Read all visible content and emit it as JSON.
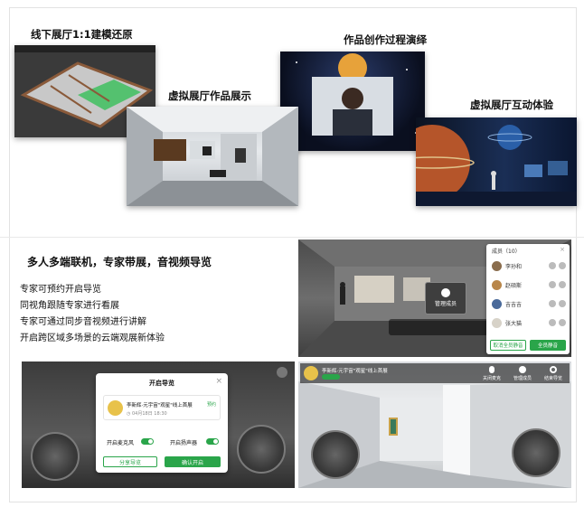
{
  "sections": {
    "top_labels": {
      "offline_model": "线下展厅1:1建模还原",
      "process": "作品创作过程演绎",
      "virtual_display": "虚拟展厅作品展示",
      "interactive": "虚拟展厅互动体验"
    },
    "middle": {
      "heading": "多人多端联机，专家带展，音视频导览",
      "bullets": [
        "专家可预约开启导览",
        "同视角跟随专家进行看展",
        "专家可通过同步音视频进行讲解",
        "开启跨区域多场景的云端观展新体验"
      ]
    }
  },
  "members_panel": {
    "title": "成员（10）",
    "manage_label": "管理成员",
    "rows": [
      "李孙和",
      "赵硕斯",
      "吉吉吉",
      "张大猫"
    ],
    "btn_all_mute": "取消全员静音",
    "btn_all_unmute": "全员静音"
  },
  "tour_dialog": {
    "title": "开启导览",
    "event_title": "李新辉·元宇宙\"观星\"线上首展",
    "event_status": "预约",
    "event_time": "04月18日 18:30",
    "mic_label": "开启麦克风",
    "speaker_label": "开启扬声器",
    "share_btn": "分享导览",
    "confirm_btn": "确认开启"
  },
  "live_bar": {
    "title": "李新辉·元宇宙\"观星\"线上首展",
    "icons": [
      {
        "icon": "mic-icon",
        "label": "关闭麦克"
      },
      {
        "icon": "members-icon",
        "label": "管理成员"
      },
      {
        "icon": "gear-icon",
        "label": "结束导览"
      }
    ]
  },
  "colors": {
    "accent_green": "#2aa54a"
  }
}
